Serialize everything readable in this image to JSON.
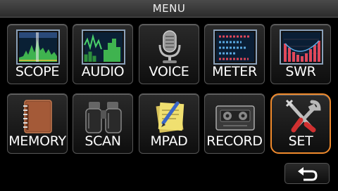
{
  "header": {
    "title": "MENU"
  },
  "tiles": [
    {
      "label": "SCOPE",
      "icon": "spectrum-scope-icon",
      "active": false
    },
    {
      "label": "AUDIO",
      "icon": "audio-scope-icon",
      "active": false
    },
    {
      "label": "VOICE",
      "icon": "microphone-icon",
      "active": false
    },
    {
      "label": "METER",
      "icon": "meter-icon",
      "active": false
    },
    {
      "label": "SWR",
      "icon": "swr-graph-icon",
      "active": false
    },
    {
      "label": "MEMORY",
      "icon": "memory-book-icon",
      "active": false
    },
    {
      "label": "SCAN",
      "icon": "binoculars-icon",
      "active": false
    },
    {
      "label": "MPAD",
      "icon": "memo-pad-icon",
      "active": false
    },
    {
      "label": "RECORD",
      "icon": "cassette-icon",
      "active": false
    },
    {
      "label": "SET",
      "icon": "tools-icon",
      "active": true
    }
  ],
  "colors": {
    "highlight": "#f08a2c",
    "background": "#000000",
    "tile_border": "#555555"
  },
  "back_button": {
    "icon": "return-arrow-icon"
  }
}
